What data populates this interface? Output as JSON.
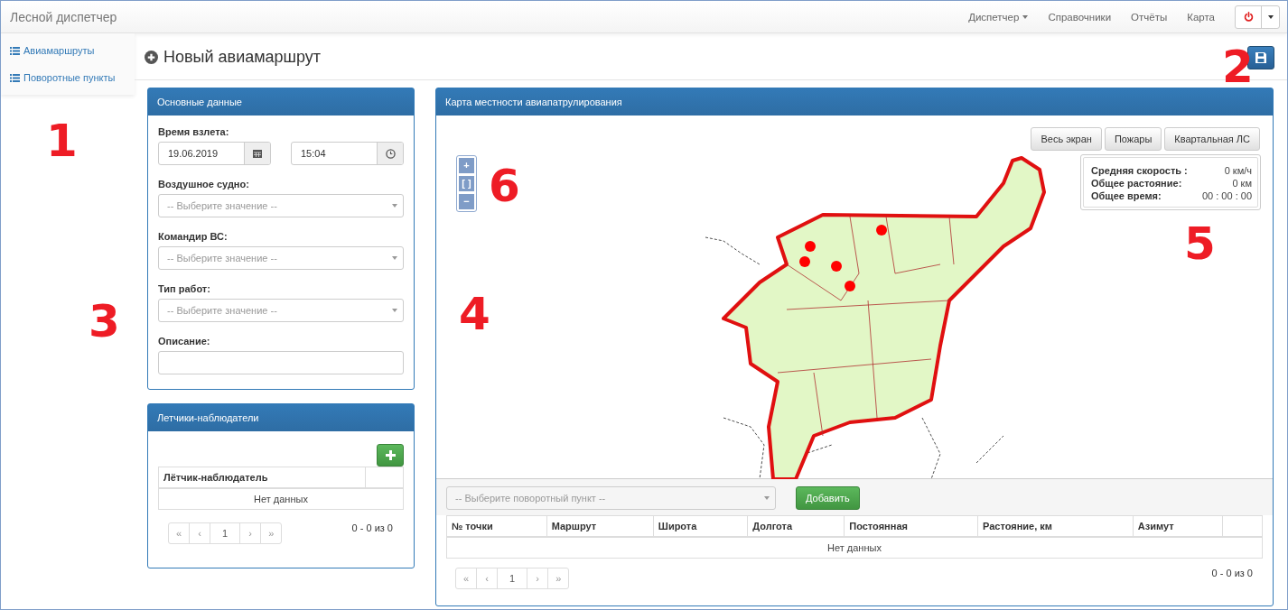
{
  "navbar": {
    "brand": "Лесной диспетчер",
    "items": [
      {
        "label": "Диспетчер",
        "has_caret": true
      },
      {
        "label": "Справочники",
        "has_caret": false
      },
      {
        "label": "Отчёты",
        "has_caret": false
      },
      {
        "label": "Карта",
        "has_caret": false
      }
    ]
  },
  "sidebar": {
    "items": [
      {
        "label": "Авиамаршруты"
      },
      {
        "label": "Поворотные пункты"
      }
    ]
  },
  "page_title": "Новый авиамаршрут",
  "main_panel": {
    "title": "Основные данные",
    "takeoff": {
      "label": "Время взлета:",
      "date": "19.06.2019",
      "time": "15:04"
    },
    "fields": [
      {
        "label": "Воздушное судно:",
        "kind": "select",
        "placeholder": "-- Выберите значение --"
      },
      {
        "label": "Командир ВС:",
        "kind": "select",
        "placeholder": "-- Выберите значение --"
      },
      {
        "label": "Тип работ:",
        "kind": "select",
        "placeholder": "-- Выберите значение --"
      },
      {
        "label": "Описание:",
        "kind": "text"
      }
    ]
  },
  "pilots_panel": {
    "title": "Летчики-наблюдатели",
    "columns": [
      "Лётчик-наблюдатель"
    ],
    "empty": "Нет данных",
    "pages": [
      "«",
      "‹",
      "1",
      "›",
      "»"
    ],
    "count": "0 - 0 из 0"
  },
  "map_panel": {
    "title": "Карта местности авиапатрулирования",
    "zoom": [
      "+",
      "[ ]",
      "−"
    ],
    "layer_buttons": [
      "Весь экран",
      "Пожары",
      "Квартальная ЛС"
    ],
    "stats": [
      {
        "label": "Средняя скорость :",
        "value": "0 км/ч"
      },
      {
        "label": "Общее растояние:",
        "value": "0 км"
      },
      {
        "label": "Общее время:",
        "value": "00 : 00 : 00"
      }
    ],
    "point_select": {
      "placeholder": "-- Выберите поворотный пункт --"
    },
    "add_button": "Добавить",
    "columns": [
      "№ точки",
      "Маршрут",
      "Широта",
      "Долгота",
      "Постоянная",
      "Растояние, км",
      "Азимут"
    ],
    "empty": "Нет данных",
    "pages": [
      "«",
      "‹",
      "1",
      "›",
      "»"
    ],
    "count": "0 - 0 из 0"
  },
  "annotations": [
    "1",
    "2",
    "3",
    "4",
    "5",
    "6"
  ]
}
